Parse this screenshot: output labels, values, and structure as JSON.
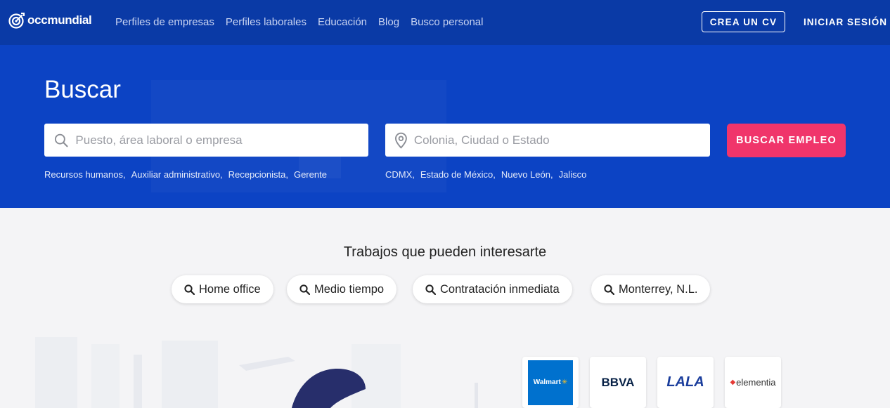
{
  "header": {
    "logo_text": "occmundial",
    "nav": [
      "Perfiles de empresas",
      "Perfiles laborales",
      "Educación",
      "Blog",
      "Busco personal"
    ],
    "create_cv": "CREA UN CV",
    "login": "INICIAR SESIÓN"
  },
  "hero": {
    "title": "Buscar",
    "search_placeholder": "Puesto, área laboral o empresa",
    "location_placeholder": "Colonia, Ciudad o Estado",
    "search_button": "BUSCAR EMPLEO",
    "job_suggestions": [
      "Recursos humanos,",
      "Auxiliar administrativo,",
      "Recepcionista,",
      "Gerente"
    ],
    "location_suggestions": [
      "CDMX,",
      "Estado de México,",
      "Nuevo León,",
      "Jalisco"
    ]
  },
  "interests": {
    "title": "Trabajos que pueden interesarte",
    "chips": [
      "Home office",
      "Medio tiempo",
      "Contratación inmediata",
      "Monterrey, N.L."
    ]
  },
  "companies": [
    {
      "name": "Walmart",
      "color": "#0071ce"
    },
    {
      "name": "BBVA",
      "color": "#072146"
    },
    {
      "name": "LALA",
      "color": "#1a3d9c"
    },
    {
      "name": "elementia",
      "color": "#333333"
    }
  ],
  "colors": {
    "topbar": "#0a3aa6",
    "hero": "#0c43c4",
    "accent": "#f0356b"
  }
}
